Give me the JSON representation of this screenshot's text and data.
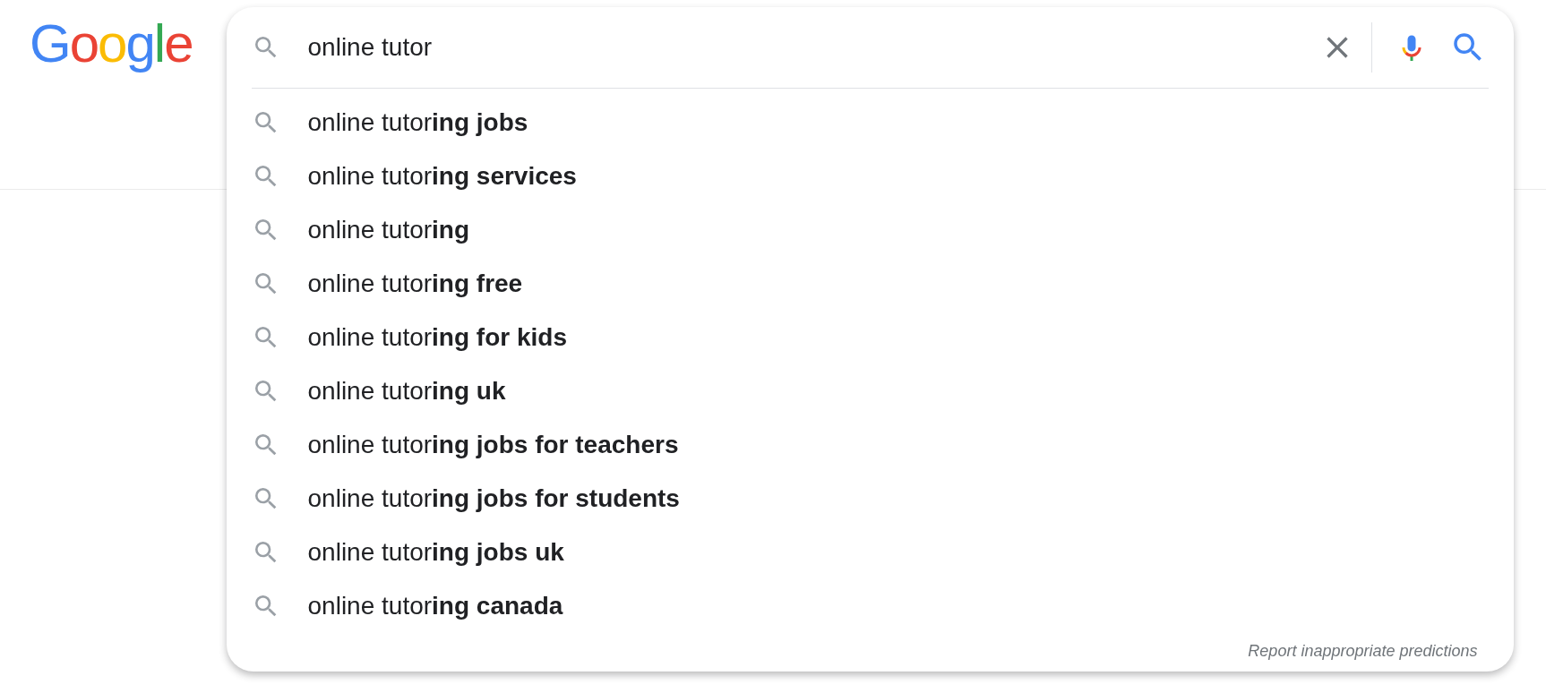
{
  "logo": {
    "letters": [
      {
        "char": "G",
        "color": "#4285f4"
      },
      {
        "char": "o",
        "color": "#ea4335"
      },
      {
        "char": "o",
        "color": "#fbbc05"
      },
      {
        "char": "g",
        "color": "#4285f4"
      },
      {
        "char": "l",
        "color": "#34a853"
      },
      {
        "char": "e",
        "color": "#ea4335"
      }
    ]
  },
  "search": {
    "value": "online tutor"
  },
  "suggestions": [
    {
      "text": "online tutor**ing jobs**"
    },
    {
      "text": "online tutor**ing services**"
    },
    {
      "text": "online tutor**ing**"
    },
    {
      "text": "online tutor**ing free**"
    },
    {
      "text": "online tutor**ing for kids**"
    },
    {
      "text": "online tutor**ing uk**"
    },
    {
      "text": "online tutor**ing jobs for teachers**"
    },
    {
      "text": "online tutor**ing jobs for students**"
    },
    {
      "text": "online tutor**ing jobs uk**"
    },
    {
      "text": "online tutor**ing canada**"
    }
  ],
  "report_link": "Report inappropriate predictions"
}
